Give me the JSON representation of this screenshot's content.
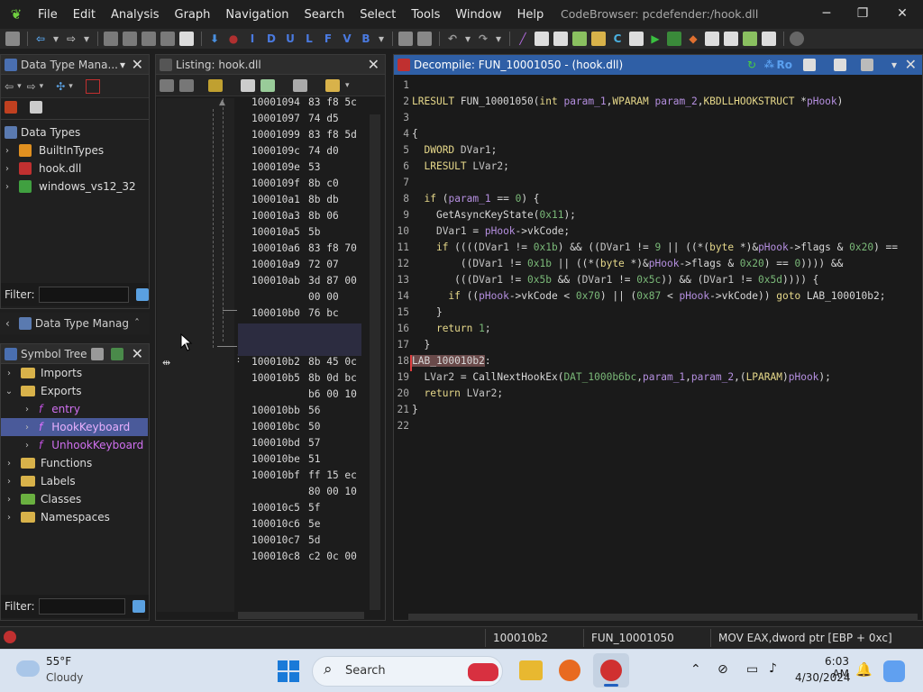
{
  "title_bar": {
    "menus": [
      "File",
      "Edit",
      "Analysis",
      "Graph",
      "Navigation",
      "Search",
      "Select",
      "Tools",
      "Window",
      "Help"
    ],
    "window_title": "CodeBrowser: pcdefender:/hook.dll"
  },
  "data_type_manager": {
    "title": "Data Type Mana...",
    "root": "Data Types",
    "items": [
      "BuiltInTypes",
      "hook.dll",
      "windows_vs12_32"
    ],
    "filter_label": "Filter:",
    "collapsed_tab": "Data Type Manag"
  },
  "symbol_tree": {
    "title": "Symbol Tree",
    "items": [
      {
        "label": "Imports"
      },
      {
        "label": "Exports"
      },
      {
        "label": "entry"
      },
      {
        "label": "HookKeyboard"
      },
      {
        "label": "UnhookKeyboard"
      },
      {
        "label": "Functions"
      },
      {
        "label": "Labels"
      },
      {
        "label": "Classes"
      },
      {
        "label": "Namespaces"
      }
    ],
    "filter_label": "Filter:"
  },
  "listing": {
    "title": "Listing:  hook.dll",
    "rows": [
      {
        "addr": "10001094",
        "bytes": "83 f8 5c"
      },
      {
        "addr": "10001097",
        "bytes": "74 d5"
      },
      {
        "addr": "10001099",
        "bytes": "83 f8 5d"
      },
      {
        "addr": "1000109c",
        "bytes": "74 d0"
      },
      {
        "addr": "1000109e",
        "bytes": "53"
      },
      {
        "addr": "1000109f",
        "bytes": "8b c0"
      },
      {
        "addr": "100010a1",
        "bytes": "8b db"
      },
      {
        "addr": "100010a3",
        "bytes": "8b 06"
      },
      {
        "addr": "100010a5",
        "bytes": "5b"
      },
      {
        "addr": "100010a6",
        "bytes": "83 f8 70"
      },
      {
        "addr": "100010a9",
        "bytes": "72 07"
      },
      {
        "addr": "100010ab",
        "bytes": "3d 87 00"
      },
      {
        "addr": "",
        "bytes": "00 00"
      },
      {
        "addr": "100010b0",
        "bytes": "76 bc"
      },
      {
        "addr": "",
        "bytes": ""
      },
      {
        "addr": "",
        "bytes": ""
      },
      {
        "addr": "100010b2",
        "bytes": "8b 45 0c"
      },
      {
        "addr": "100010b5",
        "bytes": "8b 0d bc"
      },
      {
        "addr": "",
        "bytes": "b6 00 10"
      },
      {
        "addr": "100010bb",
        "bytes": "56"
      },
      {
        "addr": "100010bc",
        "bytes": "50"
      },
      {
        "addr": "100010bd",
        "bytes": "57"
      },
      {
        "addr": "100010be",
        "bytes": "51"
      },
      {
        "addr": "100010bf",
        "bytes": "ff 15 ec"
      },
      {
        "addr": "",
        "bytes": "80 00 10"
      },
      {
        "addr": "100010c5",
        "bytes": "5f"
      },
      {
        "addr": "100010c6",
        "bytes": "5e"
      },
      {
        "addr": "100010c7",
        "bytes": "5d"
      },
      {
        "addr": "100010c8",
        "bytes": "c2 0c 00"
      }
    ]
  },
  "decompile": {
    "title": "Decompile: FUN_10001050 -  (hook.dll)",
    "line_numbers": [
      "1",
      "2",
      "3",
      "4",
      "5",
      "6",
      "7",
      "8",
      "9",
      "10",
      "11",
      "12",
      "13",
      "14",
      "15",
      "16",
      "17",
      "18",
      "19",
      "20",
      "21",
      "22"
    ]
  },
  "status_bar": {
    "address": "100010b2",
    "function": "FUN_10001050",
    "instruction": "MOV EAX,dword ptr [EBP + 0xc]"
  },
  "taskbar": {
    "weather_temp": "55°F",
    "weather_desc": "Cloudy",
    "search_placeholder": "Search",
    "time": "6:03 AM",
    "date": "4/30/2024"
  },
  "colors": {
    "accent_blue": "#2f5fa6",
    "selection": "#4a5a9a",
    "label_highlight": "#6a4a4a"
  }
}
